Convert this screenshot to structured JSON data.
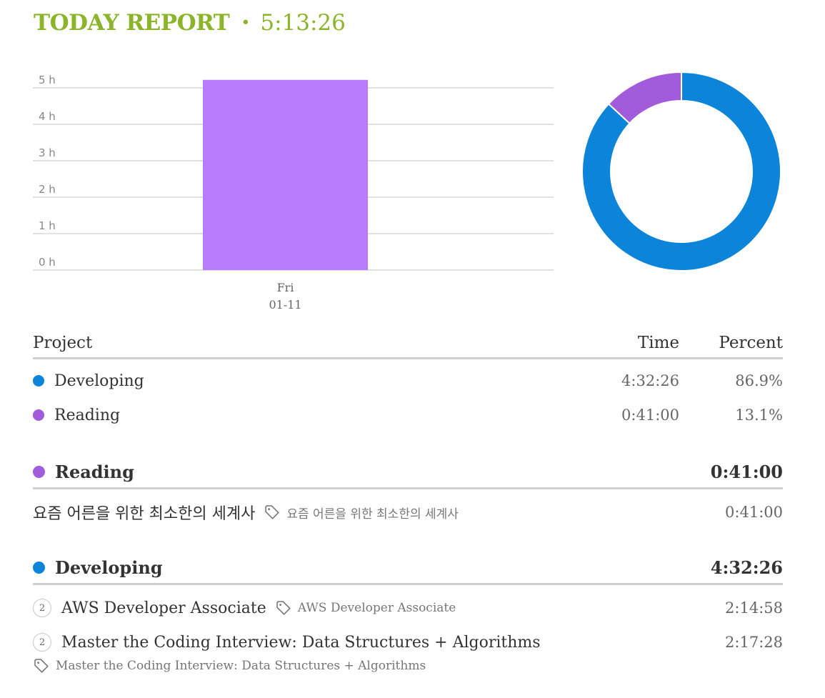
{
  "header": {
    "title": "TODAY REPORT",
    "separator": "•",
    "total": "5:13:26"
  },
  "chart_data": [
    {
      "type": "bar",
      "categories": [
        "Fri\n01-11"
      ],
      "category_lines": [
        [
          "Fri",
          "01-11"
        ]
      ],
      "values": [
        5.22
      ],
      "y_ticks": [
        "0 h",
        "1 h",
        "2 h",
        "3 h",
        "4 h",
        "5 h"
      ],
      "ylim": [
        0,
        5
      ],
      "grid": true,
      "color": "#b87bfc"
    },
    {
      "type": "pie",
      "donut": true,
      "labels": [
        "Developing",
        "Reading"
      ],
      "values": [
        86.9,
        13.1
      ],
      "colors": [
        "#0b84d9",
        "#a25bdb"
      ]
    }
  ],
  "table": {
    "headers": {
      "project": "Project",
      "time": "Time",
      "percent": "Percent"
    },
    "rows": [
      {
        "name": "Developing",
        "time": "4:32:26",
        "percent": "86.9%",
        "color": "#0b84d9"
      },
      {
        "name": "Reading",
        "time": "0:41:00",
        "percent": "13.1%",
        "color": "#a25bdb"
      }
    ]
  },
  "groups": [
    {
      "name": "Reading",
      "time": "0:41:00",
      "color": "#a25bdb",
      "tasks": [
        {
          "title": "요즘 어른을 위한 최소한의 세계사",
          "tag": "요즘 어른을 위한 최소한의 세계사",
          "time": "0:41:00"
        }
      ]
    },
    {
      "name": "Developing",
      "time": "4:32:26",
      "color": "#0b84d9",
      "tasks": [
        {
          "count": "2",
          "title": "AWS Developer Associate",
          "tag": "AWS Developer Associate",
          "time": "2:14:58"
        },
        {
          "count": "2",
          "title": "Master the Coding Interview: Data Structures + Algorithms",
          "tag": "Master the Coding Interview: Data Structures + Algorithms",
          "time": "2:17:28"
        }
      ]
    }
  ],
  "icons": {
    "tag": "tag-icon",
    "status_dot": "circle-dot"
  }
}
